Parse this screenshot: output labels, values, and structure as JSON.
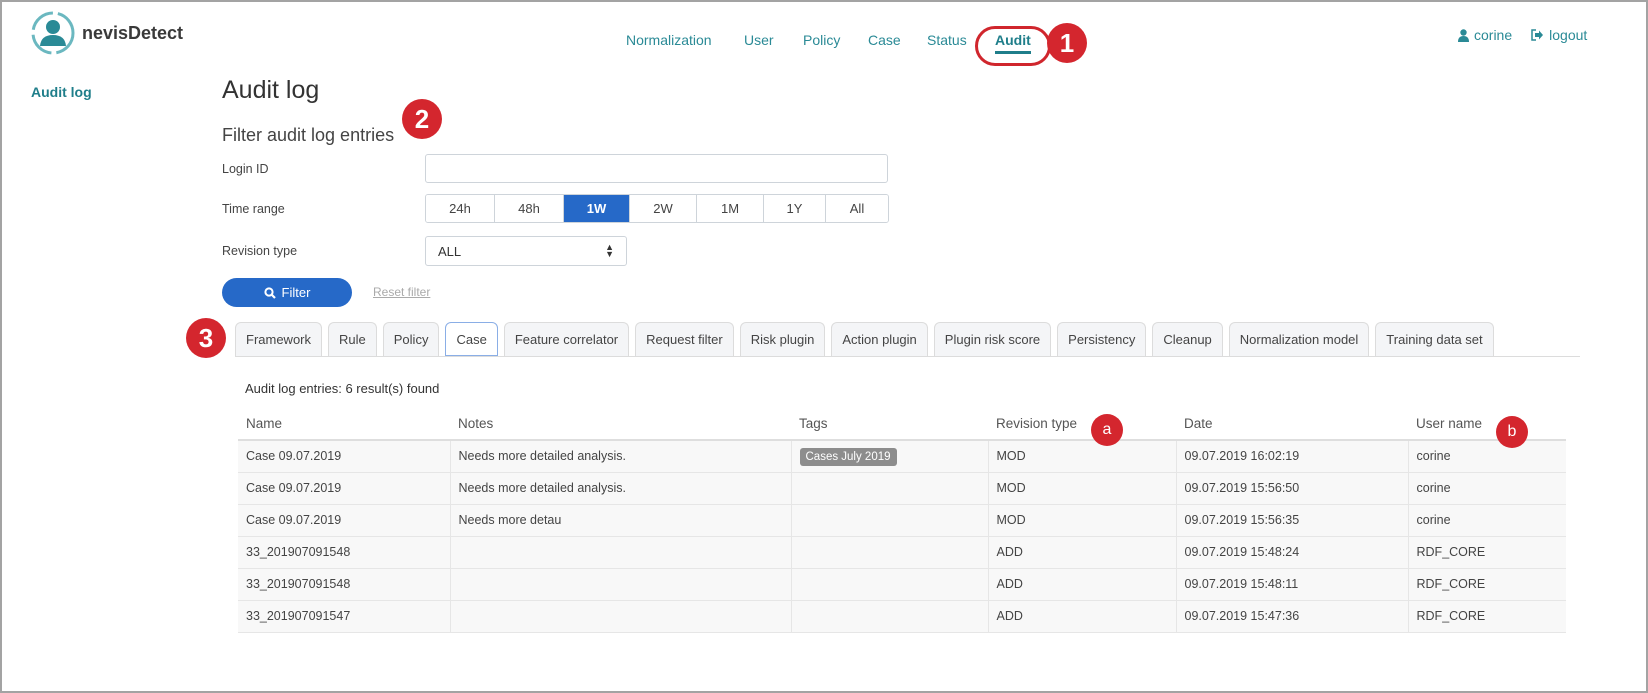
{
  "app": {
    "name": "nevisDetect"
  },
  "nav": {
    "items": [
      {
        "label": "Normalization",
        "active": false
      },
      {
        "label": "User",
        "active": false
      },
      {
        "label": "Policy",
        "active": false
      },
      {
        "label": "Case",
        "active": false
      },
      {
        "label": "Status",
        "active": false
      },
      {
        "label": "Audit",
        "active": true
      }
    ]
  },
  "user": {
    "name": "corine",
    "logout_label": "logout"
  },
  "sidebar": {
    "items": [
      {
        "label": "Audit log"
      }
    ]
  },
  "callouts": {
    "one": "1",
    "two": "2",
    "three": "3",
    "a": "a",
    "b": "b"
  },
  "page": {
    "title": "Audit log",
    "subtitle": "Filter audit log entries"
  },
  "filter": {
    "login_id_label": "Login ID",
    "login_id_value": "",
    "time_range_label": "Time range",
    "time_ranges": [
      "24h",
      "48h",
      "1W",
      "2W",
      "1M",
      "1Y",
      "All"
    ],
    "time_range_selected": "1W",
    "revision_type_label": "Revision type",
    "revision_type_value": "ALL",
    "filter_button": "Filter",
    "reset_link": "Reset filter"
  },
  "tabs": {
    "items": [
      "Framework",
      "Rule",
      "Policy",
      "Case",
      "Feature correlator",
      "Request filter",
      "Risk plugin",
      "Action plugin",
      "Plugin risk score",
      "Persistency",
      "Cleanup",
      "Normalization model",
      "Training data set"
    ],
    "active": "Case"
  },
  "results": {
    "summary": "Audit log entries: 6 result(s) found",
    "columns": [
      "Name",
      "Notes",
      "Tags",
      "Revision type",
      "Date",
      "User name"
    ],
    "rows": [
      {
        "name": "Case 09.07.2019",
        "notes": "Needs more detailed analysis.",
        "tag": "Cases July 2019",
        "revision": "MOD",
        "date": "09.07.2019 16:02:19",
        "user": "corine"
      },
      {
        "name": "Case 09.07.2019",
        "notes": "Needs more detailed analysis.",
        "tag": "",
        "revision": "MOD",
        "date": "09.07.2019 15:56:50",
        "user": "corine"
      },
      {
        "name": "Case 09.07.2019",
        "notes": "Needs more detau",
        "tag": "",
        "revision": "MOD",
        "date": "09.07.2019 15:56:35",
        "user": "corine"
      },
      {
        "name": "33_201907091548",
        "notes": "",
        "tag": "",
        "revision": "ADD",
        "date": "09.07.2019 15:48:24",
        "user": "RDF_CORE"
      },
      {
        "name": "33_201907091548",
        "notes": "",
        "tag": "",
        "revision": "ADD",
        "date": "09.07.2019 15:48:11",
        "user": "RDF_CORE"
      },
      {
        "name": "33_201907091547",
        "notes": "",
        "tag": "",
        "revision": "ADD",
        "date": "09.07.2019 15:47:36",
        "user": "RDF_CORE"
      }
    ]
  },
  "colors": {
    "brand": "#1f7e8a",
    "primary": "#2669c8",
    "callout": "#d4262e"
  }
}
